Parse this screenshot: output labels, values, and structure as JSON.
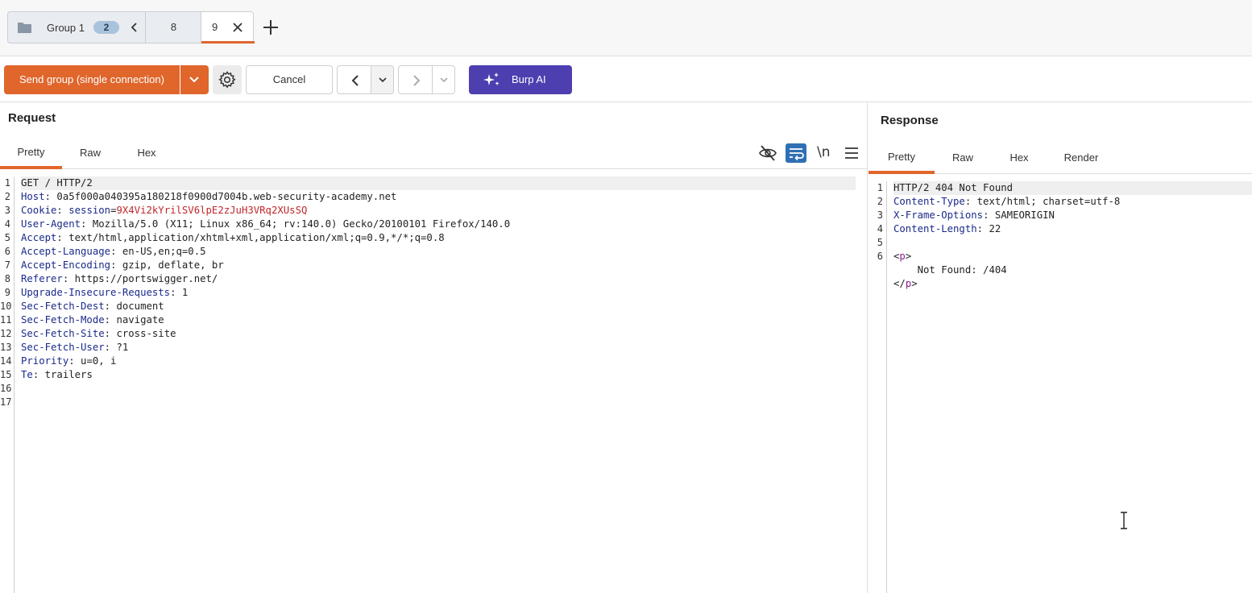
{
  "tabs": {
    "group": {
      "name": "Group 1",
      "count": "2"
    },
    "items": [
      {
        "label": "8"
      },
      {
        "label": "9"
      }
    ]
  },
  "toolbar": {
    "send_label": "Send group (single connection)",
    "cancel_label": "Cancel",
    "burp_ai_label": "Burp AI"
  },
  "request": {
    "title": "Request",
    "tabs": [
      "Pretty",
      "Raw",
      "Hex"
    ],
    "newline_toggle": "\\n",
    "line_numbers": [
      "1",
      "2",
      "3",
      "4",
      "5",
      "6",
      "7",
      "8",
      "9",
      "10",
      "11",
      "12",
      "13",
      "14",
      "15",
      "16",
      "17"
    ],
    "request_line": "GET / HTTP/2",
    "headers": [
      {
        "key": "Host",
        "value": " 0a5f000a040395a180218f0900d7004b.web-security-academy.net"
      },
      {
        "key": "Cookie",
        "value": ""
      },
      {
        "key": "User-Agent",
        "value": " Mozilla/5.0 (X11; Linux x86_64; rv:140.0) Gecko/20100101 Firefox/140.0"
      },
      {
        "key": "Accept",
        "value": " text/html,application/xhtml+xml,application/xml;q=0.9,*/*;q=0.8"
      },
      {
        "key": "Accept-Language",
        "value": " en-US,en;q=0.5"
      },
      {
        "key": "Accept-Encoding",
        "value": " gzip, deflate, br"
      },
      {
        "key": "Referer",
        "value": " https://portswigger.net/"
      },
      {
        "key": "Upgrade-Insecure-Requests",
        "value": " 1"
      },
      {
        "key": "Sec-Fetch-Dest",
        "value": " document"
      },
      {
        "key": "Sec-Fetch-Mode",
        "value": " navigate"
      },
      {
        "key": "Sec-Fetch-Site",
        "value": " cross-site"
      },
      {
        "key": "Sec-Fetch-User",
        "value": " ?1"
      },
      {
        "key": "Priority",
        "value": " u=0, i"
      },
      {
        "key": "Te",
        "value": " trailers"
      }
    ],
    "cookie": {
      "name": " session",
      "value": "9X4Vi2kYrilSV6lpE2zJuH3VRq2XUsSQ"
    }
  },
  "response": {
    "title": "Response",
    "tabs": [
      "Pretty",
      "Raw",
      "Hex",
      "Render"
    ],
    "line_numbers": [
      "1",
      "2",
      "3",
      "4",
      "5",
      "6"
    ],
    "status_line": "HTTP/2 404 Not Found",
    "headers": [
      {
        "key": "Content-Type",
        "value": " text/html; charset=utf-8"
      },
      {
        "key": "X-Frame-Options",
        "value": " SAMEORIGIN"
      },
      {
        "key": "Content-Length",
        "value": " 22"
      }
    ],
    "body_open_tag": "p",
    "body_text": "    Not Found: /404",
    "body_close_tag": "p"
  },
  "colors": {
    "accent": "#e0662c",
    "burp_ai": "#4d3fb0",
    "header_key": "#1a2a8a",
    "cookie_value": "#c0262d",
    "html_tag": "#8a1d8a"
  }
}
